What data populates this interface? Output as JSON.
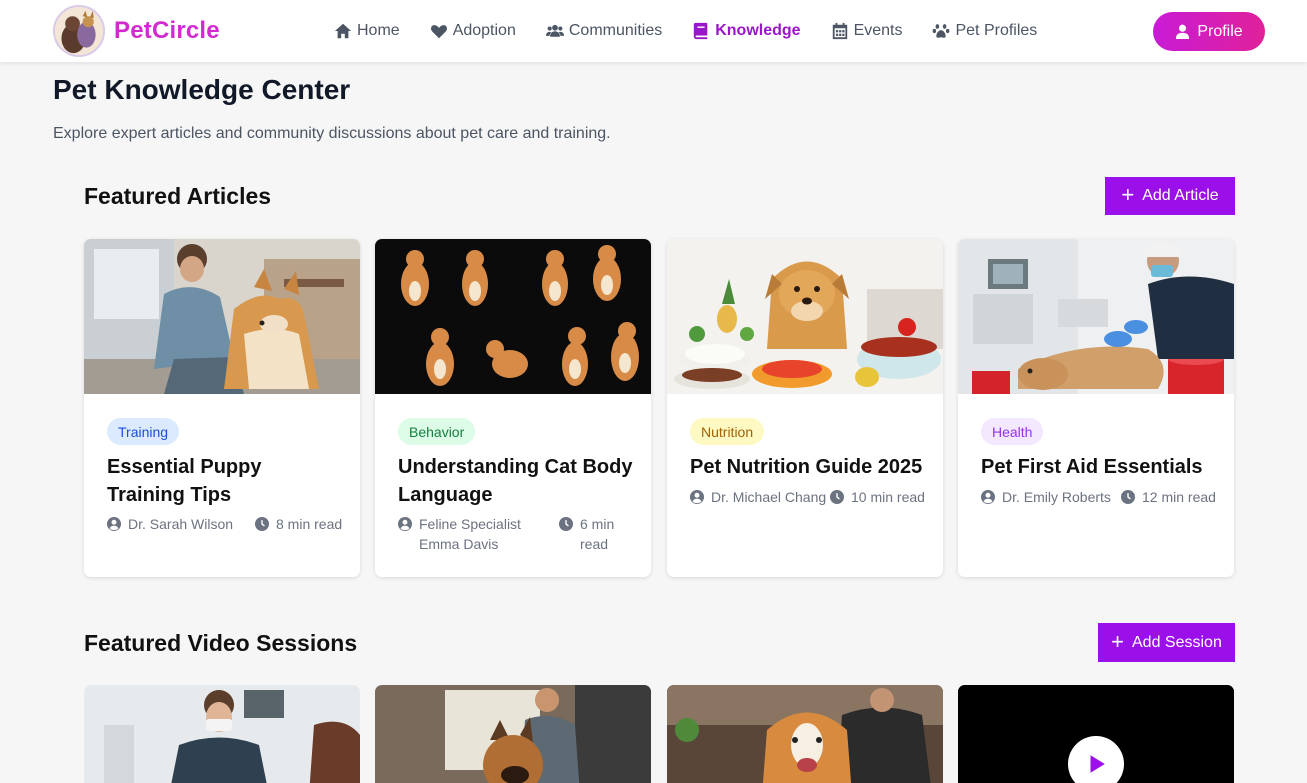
{
  "app": {
    "name": "PetCircle",
    "accent": "#9b10e8",
    "brand": "#d12bd0"
  },
  "nav": {
    "items": [
      {
        "label": "Home",
        "icon": "home-icon",
        "active": false
      },
      {
        "label": "Adoption",
        "icon": "heart-icon",
        "active": false
      },
      {
        "label": "Communities",
        "icon": "users-icon",
        "active": false
      },
      {
        "label": "Knowledge",
        "icon": "book-icon",
        "active": true
      },
      {
        "label": "Events",
        "icon": "calendar-icon",
        "active": false
      },
      {
        "label": "Pet Profiles",
        "icon": "paw-icon",
        "active": false
      }
    ],
    "profile_label": "Profile"
  },
  "page": {
    "title": "Pet Knowledge Center",
    "subtitle": "Explore expert articles and community discussions about pet care and training."
  },
  "articles": {
    "title": "Featured Articles",
    "add_label": "Add Article",
    "items": [
      {
        "tag": "Training",
        "title": "Essential Puppy Training Tips",
        "author": "Dr. Sarah Wilson",
        "read": "8 min read"
      },
      {
        "tag": "Behavior",
        "title": "Understanding Cat Body Language",
        "author": "Feline Specialist Emma Davis",
        "read": "6 min read"
      },
      {
        "tag": "Nutrition",
        "title": "Pet Nutrition Guide 2025",
        "author": "Dr. Michael Chang",
        "read": "10 min read"
      },
      {
        "tag": "Health",
        "title": "Pet First Aid Essentials",
        "author": "Dr. Emily Roberts",
        "read": "12 min read"
      }
    ]
  },
  "videos": {
    "title": "Featured Video Sessions",
    "add_label": "Add Session"
  },
  "colors": {
    "tag_training_bg": "#dbeafe",
    "tag_training_fg": "#1d4ed8",
    "tag_behavior_bg": "#dcfce7",
    "tag_behavior_fg": "#15803d",
    "tag_nutrition_bg": "#fef9c3",
    "tag_nutrition_fg": "#a16207",
    "tag_health_bg": "#f3e8ff",
    "tag_health_fg": "#9333ea"
  }
}
